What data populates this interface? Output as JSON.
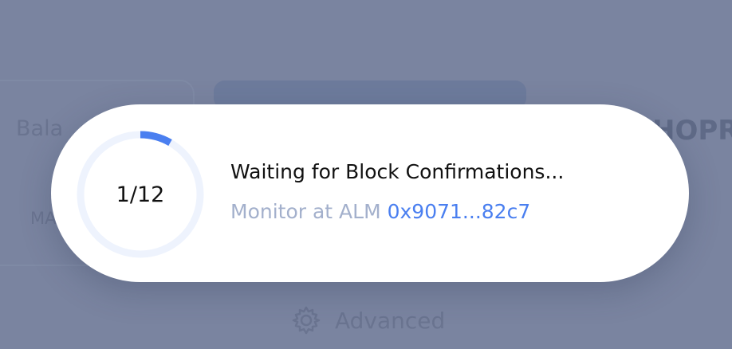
{
  "background": {
    "balance_label": "Bala",
    "max_label": "MA",
    "token_label": "HOPR",
    "advanced_label": "Advanced",
    "advanced_icon": "gear-icon"
  },
  "modal": {
    "progress": {
      "label": "1/12",
      "current": 1,
      "total": 12,
      "track_color": "#eef3fd",
      "fill_color": "#4a7ff0"
    },
    "title": "Waiting for Block Confirmations...",
    "monitor_text": "Monitor at ALM",
    "tx_hash": "0x9071...82c7"
  }
}
